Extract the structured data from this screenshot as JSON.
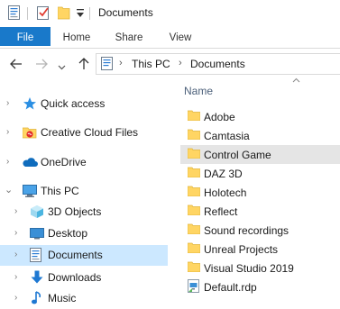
{
  "window": {
    "title": "Documents",
    "quick_access_toolbar": [
      "properties-icon",
      "checkmark-icon",
      "new-folder-icon",
      "dropdown-arrow-icon"
    ]
  },
  "ribbon": {
    "tabs": [
      {
        "label": "File",
        "active": true
      },
      {
        "label": "Home"
      },
      {
        "label": "Share"
      },
      {
        "label": "View"
      }
    ]
  },
  "address_bar": {
    "crumbs": [
      "This PC",
      "Documents"
    ]
  },
  "nav_pane": {
    "items": [
      {
        "label": "Quick access",
        "icon": "star-icon"
      },
      {
        "label": "Creative Cloud Files",
        "icon": "creative-cloud-icon"
      },
      {
        "label": "OneDrive",
        "icon": "cloud-icon"
      },
      {
        "label": "This PC",
        "icon": "computer-icon",
        "expanded": true
      },
      {
        "label": "3D Objects",
        "icon": "cube-icon"
      },
      {
        "label": "Desktop",
        "icon": "desktop-icon"
      },
      {
        "label": "Documents",
        "icon": "documents-icon",
        "selected": true
      },
      {
        "label": "Downloads",
        "icon": "download-icon"
      },
      {
        "label": "Music",
        "icon": "music-icon"
      }
    ]
  },
  "file_list": {
    "column_header": "Name",
    "items": [
      {
        "label": "Adobe",
        "type": "folder"
      },
      {
        "label": "Camtasia",
        "type": "folder"
      },
      {
        "label": "Control Game",
        "type": "folder",
        "hover": true
      },
      {
        "label": "DAZ 3D",
        "type": "folder"
      },
      {
        "label": "Holotech",
        "type": "folder"
      },
      {
        "label": "Reflect",
        "type": "folder"
      },
      {
        "label": "Sound recordings",
        "type": "folder"
      },
      {
        "label": "Unreal Projects",
        "type": "folder"
      },
      {
        "label": "Visual Studio 2019",
        "type": "folder"
      },
      {
        "label": "Default.rdp",
        "type": "rdp"
      }
    ]
  },
  "colors": {
    "accent": "#1979ca",
    "selected": "#cce8ff",
    "hover": "#e5e5e5",
    "folder": "#ffd563"
  }
}
